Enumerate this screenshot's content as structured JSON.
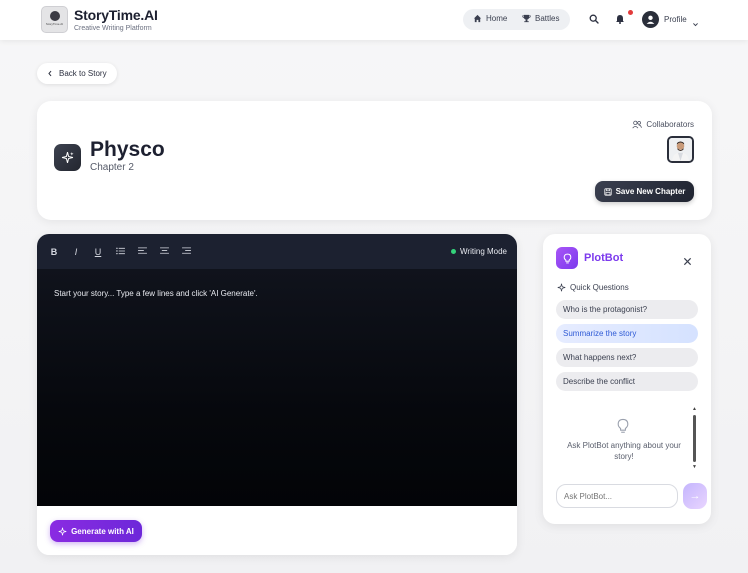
{
  "header": {
    "logo_text": "StoryTime.AI",
    "brand_title": "StoryTime.AI",
    "brand_subtitle": "Creative Writing Platform",
    "nav": [
      {
        "label": "Home",
        "icon": "home-icon"
      },
      {
        "label": "Battles",
        "icon": "trophy-icon"
      }
    ],
    "profile_label": "Profile",
    "notification_color": "#e23b3b"
  },
  "back_button": {
    "label": "Back to Story"
  },
  "story": {
    "title": "Physco",
    "chapter": "Chapter 2",
    "collaborators_label": "Collaborators",
    "save_label": "Save New Chapter"
  },
  "editor": {
    "toolbar": [
      "B",
      "I",
      "U",
      "list",
      "align-left",
      "align-center",
      "align-right"
    ],
    "mode_label": "Writing Mode",
    "placeholder": "Start your story... Type a few lines and click 'AI Generate'.",
    "generate_label": "Generate with AI"
  },
  "plotbot": {
    "title": "PlotBot",
    "quick_label": "Quick Questions",
    "questions": [
      "Who is the protagonist?",
      "Summarize the story",
      "What happens next?",
      "Describe the conflict"
    ],
    "active_question_index": 1,
    "hint": "Ask PlotBot anything about your story!",
    "input_placeholder": "Ask PlotBot...",
    "accent": "#7c3aed"
  }
}
